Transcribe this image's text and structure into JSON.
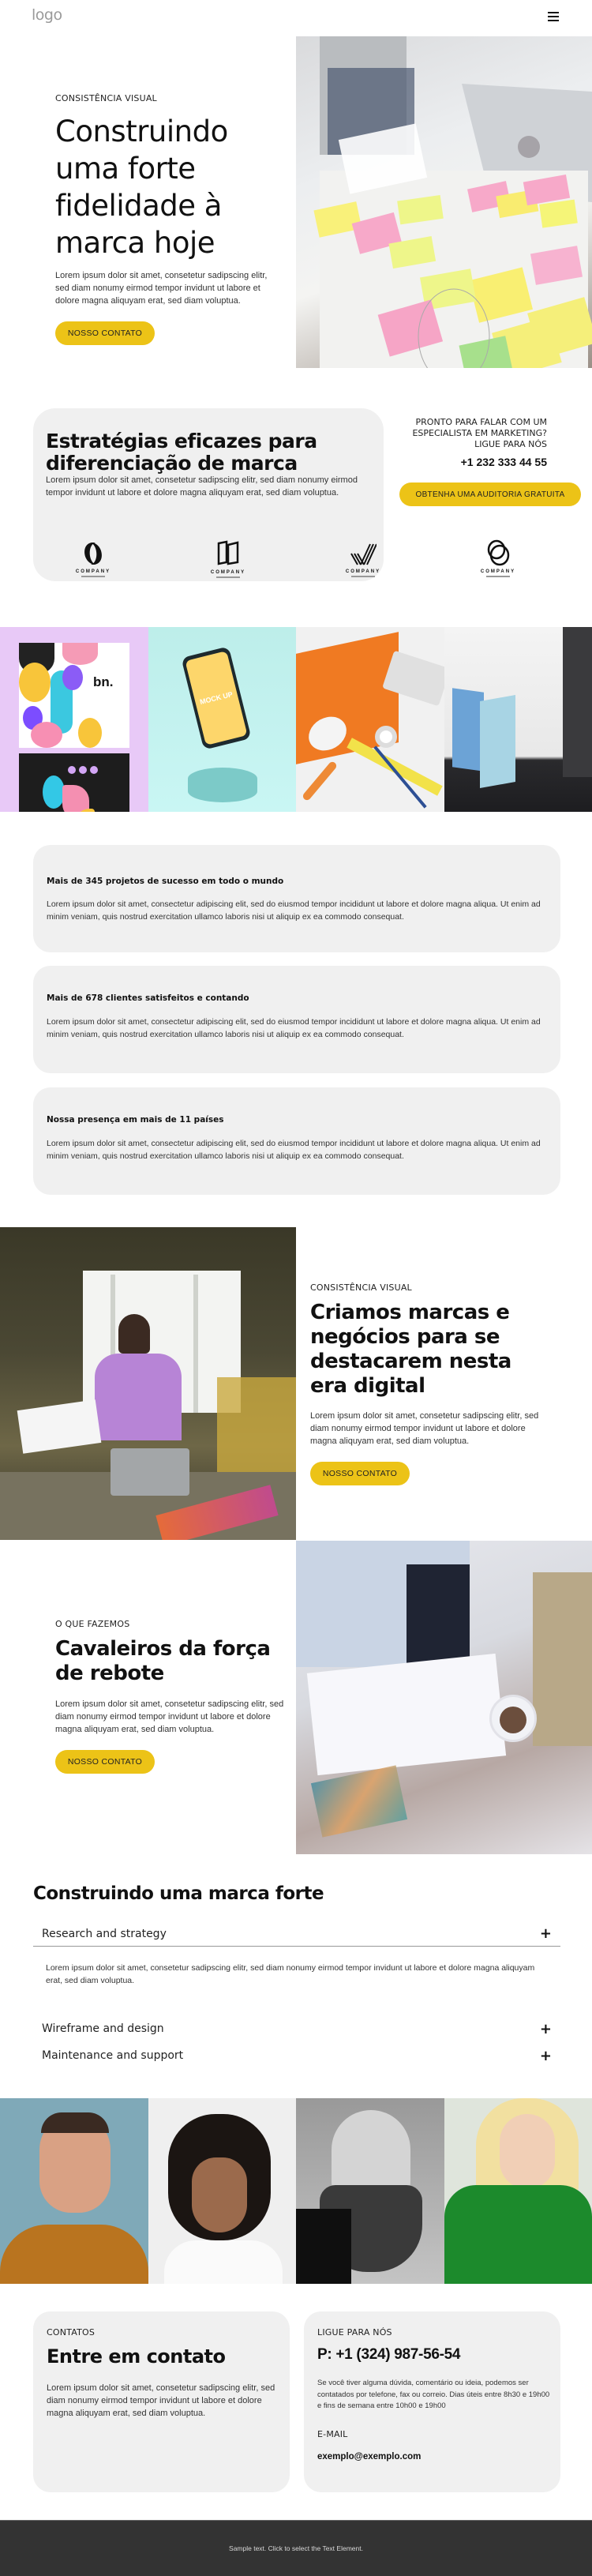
{
  "header": {
    "logo_text": "logo",
    "menu_icon": "hamburger-menu-icon"
  },
  "hero": {
    "eyebrow": "CONSISTÊNCIA VISUAL",
    "title_lines": [
      "Construindo",
      "uma forte",
      "fidelidade à",
      "marca hoje"
    ],
    "body": "Lorem ipsum dolor sit amet, consetetur sadipscing elitr, sed diam nonumy eirmod tempor invidunt ut labore et dolore magna aliquyam erat, sed diam voluptua.",
    "button_label": "NOSSO CONTATO",
    "image_alt": "Team planning branding with sticky notes"
  },
  "strategy": {
    "title": "Estratégias eficazes para diferenciação de marca",
    "body": "Lorem ipsum dolor sit amet, consetetur sadipscing elitr, sed diam nonumy eirmod tempor invidunt ut labore et dolore magna aliquyam erat, sed diam voluptua.",
    "cta_prompt_lines": [
      "PRONTO PARA FALAR COM UM",
      "ESPECIALISTA EM MARKETING?",
      "LIGUE PARA NÓS"
    ],
    "phone": "+1 232 333 44 55",
    "button_label": "OBTENHA UMA AUDITORIA GRATUITA"
  },
  "logos": [
    {
      "caption": "COMPANY",
      "icon": "company-logo-o-icon"
    },
    {
      "caption": "COMPANY",
      "icon": "company-logo-book-icon"
    },
    {
      "caption": "COMPANY",
      "icon": "company-logo-check-icon"
    },
    {
      "caption": "COMPANY",
      "icon": "company-logo-rings-icon"
    }
  ],
  "gallery": [
    {
      "label": "business-cards-mockup",
      "card_text": "bn."
    },
    {
      "label": "phone-mockup",
      "card_text": "MOCK UP"
    },
    {
      "label": "stationery-flatlay"
    },
    {
      "label": "paper-cards-mockup"
    }
  ],
  "stats": [
    {
      "title": "Mais de 345 projetos de sucesso em todo o mundo",
      "body": "Lorem ipsum dolor sit amet, consectetur adipiscing elit, sed do eiusmod tempor incididunt ut labore et dolore magna aliqua. Ut enim ad minim veniam, quis nostrud exercitation ullamco laboris nisi ut aliquip ex ea commodo consequat."
    },
    {
      "title": "Mais de 678 clientes satisfeitos e contando",
      "body": "Lorem ipsum dolor sit amet, consectetur adipiscing elit, sed do eiusmod tempor incididunt ut labore et dolore magna aliqua. Ut enim ad minim veniam, quis nostrud exercitation ullamco laboris nisi ut aliquip ex ea commodo consequat."
    },
    {
      "title": "Nossa presença em mais de 11 países",
      "body": "Lorem ipsum dolor sit amet, consectetur adipiscing elit, sed do eiusmod tempor incididunt ut labore et dolore magna aliqua. Ut enim ad minim veniam, quis nostrud exercitation ullamco laboris nisi ut aliquip ex ea commodo consequat."
    }
  ],
  "brands": {
    "eyebrow": "CONSISTÊNCIA VISUAL",
    "title": "Criamos marcas e negócios para se destacarem nesta era digital",
    "body": "Lorem ipsum dolor sit amet, consetetur sadipscing elitr, sed diam nonumy eirmod tempor invidunt ut labore et dolore magna aliquyam erat, sed diam voluptua.",
    "button_label": "NOSSO CONTATO"
  },
  "whatwedo": {
    "eyebrow": "O QUE FAZEMOS",
    "title": "Cavaleiros da força de rebote",
    "body": "Lorem ipsum dolor sit amet, consetetur sadipscing elitr, sed diam nonumy eirmod tempor invidunt ut labore et dolore magna aliquyam erat, sed diam voluptua.",
    "button_label": "NOSSO CONTATO"
  },
  "accordion": {
    "title": "Construindo uma marca forte",
    "items": [
      {
        "label": "Research and strategy",
        "expanded": true,
        "body": "Lorem ipsum dolor sit amet, consetetur sadipscing elitr, sed diam nonumy eirmod tempor invidunt ut labore et dolore magna aliquyam erat, sed diam voluptua."
      },
      {
        "label": "Wireframe and design",
        "expanded": false
      },
      {
        "label": "Maintenance and support",
        "expanded": false
      }
    ],
    "toggle_symbol": "+"
  },
  "team": [
    {
      "label": "team-member-1"
    },
    {
      "label": "team-member-2"
    },
    {
      "label": "team-member-3"
    },
    {
      "label": "team-member-4"
    }
  ],
  "contact": {
    "eyebrow": "CONTATOS",
    "title": "Entre em contato",
    "body": "Lorem ipsum dolor sit amet, consetetur sadipscing elitr, sed diam nonumy eirmod tempor invidunt ut labore et dolore magna aliquyam erat, sed diam voluptua.",
    "call_eyebrow": "LIGUE PARA NÓS",
    "phone": "P: +1 (324) 987-56-54",
    "call_body": "Se você tiver alguma dúvida, comentário ou ideia, podemos ser contatados por telefone, fax ou correio. Dias úteis entre 8h30 e 19h00 e fins de semana entre 10h00 e 19h00",
    "email_label": "E-MAIL",
    "email": "exemplo@exemplo.com"
  },
  "footer": {
    "text": "Sample text. Click to select the Text Element."
  },
  "colors": {
    "accent": "#ecc317",
    "card_bg": "#f0f0f0",
    "footer_bg": "#333333"
  }
}
